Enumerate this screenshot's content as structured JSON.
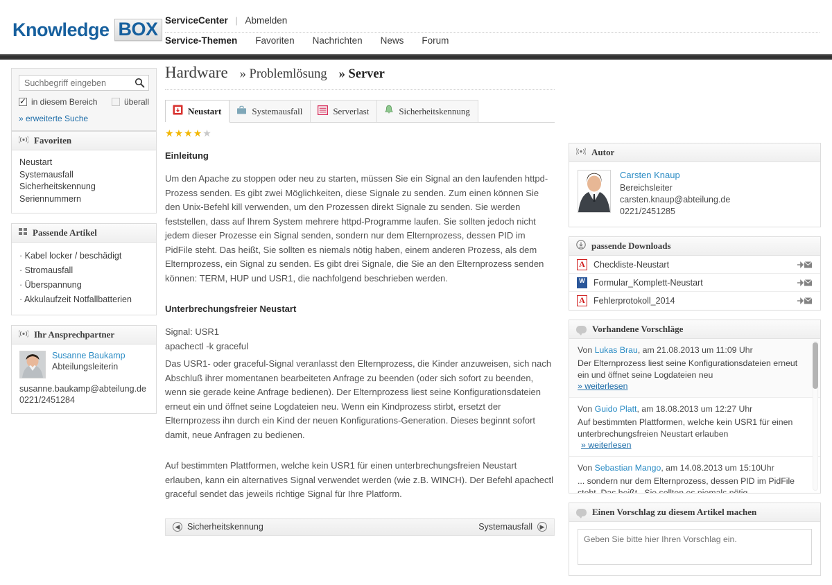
{
  "header": {
    "logo_main": "Knowledge",
    "logo_box": "BOX",
    "top_links": [
      {
        "label": "ServiceCenter",
        "bold": true
      },
      {
        "label": "Abmelden",
        "bold": false
      }
    ],
    "nav": [
      {
        "label": "Service-Themen",
        "active": true
      },
      {
        "label": "Favoriten",
        "active": false
      },
      {
        "label": "Nachrichten",
        "active": false
      },
      {
        "label": "News",
        "active": false
      },
      {
        "label": "Forum",
        "active": false
      }
    ]
  },
  "sidebar_left": {
    "search": {
      "placeholder": "Suchbegriff eingeben",
      "value": "",
      "icon": "search-icon",
      "checkbox_scope_label": "in diesem Bereich",
      "checkbox_scope_checked": true,
      "checkbox_all_label": "überall",
      "checkbox_all_checked": false,
      "advanced_link": "» erweiterte Suche"
    },
    "favorites": {
      "icon": "broadcast-icon",
      "title": "Favoriten",
      "items": [
        "Neustart",
        "Systemausfall",
        "Sicherheitskennung",
        "Seriennummern"
      ]
    },
    "related": {
      "icon": "grid-icon",
      "title": "Passende Artikel",
      "items": [
        "Kabel locker / beschädigt",
        "Stromausfall",
        "Überspannung",
        "Akkulaufzeit Notfallbatterien"
      ]
    },
    "contact": {
      "icon": "broadcast-icon",
      "title": "Ihr Ansprechpartner",
      "name": "Susanne Baukamp",
      "role": "Abteilungsleiterin",
      "email": "susanne.baukamp@abteilung.de",
      "phone": "0221/2451284"
    }
  },
  "main": {
    "breadcrumb": {
      "level1": "Hardware",
      "level2": "» Problemlösung",
      "level3": "» Server"
    },
    "tabs": [
      {
        "label": "Neustart",
        "icon": "restart-icon",
        "active": true
      },
      {
        "label": "Systemausfall",
        "icon": "briefcase-icon",
        "active": false
      },
      {
        "label": "Serverlast",
        "icon": "server-icon",
        "active": false
      },
      {
        "label": "Sicherheitskennung",
        "icon": "bell-icon",
        "active": false
      }
    ],
    "rating": {
      "filled": 4,
      "total": 5
    },
    "section1_title": "Einleitung",
    "section1_text": "Um den Apache zu stoppen oder neu zu starten, müssen Sie ein Signal an den laufenden httpd-Prozess senden. Es gibt zwei Möglichkeiten, diese Signale zu senden. Zum einen können Sie den Unix-Befehl kill verwenden, um den Prozessen direkt Signale zu senden. Sie werden feststellen, dass auf Ihrem System mehrere httpd-Programme laufen. Sie sollten jedoch nicht jedem dieser Prozesse ein Signal senden, sondern nur dem Elternprozess, dessen PID im PidFile steht. Das heißt, Sie sollten es niemals nötig haben, einem anderen Prozess, als dem Elternprozess, ein Signal zu senden. Es gibt drei Signale, die Sie an den Elternprozess senden können: TERM, HUP und USR1, die nachfolgend beschrieben werden.",
    "section2_title": "Unterbrechungsfreier Neustart",
    "section2_line1": "Signal: USR1",
    "section2_line2": "apachectl -k graceful",
    "section2_text": "Das USR1- oder graceful-Signal veranlasst den Elternprozess, die Kinder anzuweisen, sich nach Abschluß ihrer momentanen bearbeiteten Anfrage zu beenden (oder sich sofort zu beenden, wenn sie gerade keine Anfrage bedienen). Der Elternprozess liest seine Konfigurationsdateien erneut ein und öffnet seine Logdateien neu. Wenn ein Kindprozess stirbt, ersetzt der Elternprozess ihn durch ein Kind der neuen Konfigurations-Generation. Dieses beginnt sofort damit, neue Anfragen zu bedienen.",
    "section3_text": "Auf bestimmten Plattformen, welche kein USR1 für einen unterbrechungsfreien Neustart erlauben, kann ein alternatives Signal verwendet werden (wie z.B. WINCH). Der Befehl apachectl graceful sendet das jeweils richtige Signal für Ihre Platform.",
    "pager": {
      "prev_label": "Sicherheitskennung",
      "prev_icon": "arrow-left-circle-icon",
      "next_label": "Systemausfall",
      "next_icon": "arrow-right-circle-icon"
    }
  },
  "sidebar_right": {
    "author": {
      "icon": "broadcast-icon",
      "title": "Autor",
      "name": "Carsten Knaup",
      "role": "Bereichsleiter",
      "email": "carsten.knaup@abteilung.de",
      "phone": "0221/2451285"
    },
    "downloads": {
      "icon": "download-icon",
      "title": "passende Downloads",
      "items": [
        {
          "name": "Checkliste-Neustart",
          "type": "pdf",
          "action_icon": "send-mail-icon"
        },
        {
          "name": "Formular_Komplett-Neustart",
          "type": "doc",
          "action_icon": "send-mail-icon"
        },
        {
          "name": "Fehlerprotokoll_2014",
          "type": "pdf",
          "action_icon": "send-mail-icon"
        }
      ]
    },
    "suggestions": {
      "icon": "comment-icon",
      "title": "Vorhandene Vorschläge",
      "more_label": "» weiterlesen",
      "items": [
        {
          "prefix": "Von ",
          "author": "Lukas Brau",
          "meta": ", am 21.08.2013 um 11:09 Uhr",
          "text": "Der Elternprozess liest seine Konfigurationsdateien erneut ein und öffnet seine Logdateien neu"
        },
        {
          "prefix": "Von ",
          "author": "Guido Platt",
          "meta": ", am 18.08.2013 um 12:27 Uhr",
          "text": "Auf bestimmten Plattformen, welche kein USR1 für einen unterbrechungsfreien Neustart erlauben"
        },
        {
          "prefix": "Von ",
          "author": "Sebastian Mango",
          "meta": ", am 14.08.2013 um 15:10Uhr",
          "text": "... sondern nur dem Elternprozess, dessen PID im PidFile steht. Das heißt , Sie sollten es niemals nötig ..."
        }
      ]
    },
    "new_suggestion": {
      "icon": "comment-icon",
      "title": "Einen Vorschlag zu diesem Artikel machen",
      "placeholder": "Geben Sie bitte hier Ihren Vorschlag ein.",
      "value": ""
    }
  },
  "colors": {
    "brand_blue": "#17609e",
    "link_blue": "#2a8bc4",
    "star_gold": "#f2b705",
    "pdf_red": "#cf1a1a",
    "word_blue": "#2a5699"
  }
}
